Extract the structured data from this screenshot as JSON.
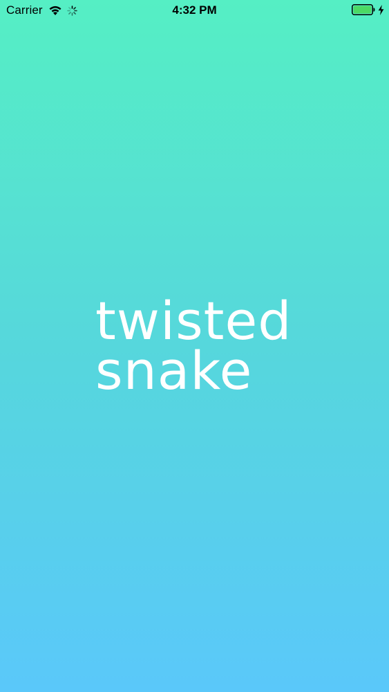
{
  "status_bar": {
    "carrier": "Carrier",
    "time": "4:32 PM",
    "icons": {
      "wifi": "wifi-icon",
      "activity": "activity-spinner-icon",
      "battery": "battery-icon",
      "charging": "charging-bolt-icon"
    },
    "battery_color": "#4cd964"
  },
  "logo": {
    "line1": "twisted",
    "line2": "snake"
  },
  "colors": {
    "gradient_top": "#55efc4",
    "gradient_bottom": "#5ac8fa",
    "logo_text": "#ffffff"
  }
}
